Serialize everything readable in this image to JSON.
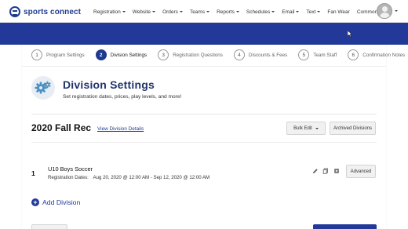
{
  "brand": {
    "name": "sports connect",
    "color": "#1f3b8f"
  },
  "nav": {
    "items": [
      {
        "label": "Registration",
        "dropdown": true
      },
      {
        "label": "Website",
        "dropdown": true
      },
      {
        "label": "Orders",
        "dropdown": true
      },
      {
        "label": "Teams",
        "dropdown": true
      },
      {
        "label": "Reports",
        "dropdown": true
      },
      {
        "label": "Schedules",
        "dropdown": true
      },
      {
        "label": "Email",
        "dropdown": true
      },
      {
        "label": "Text",
        "dropdown": true
      },
      {
        "label": "Fan Wear",
        "dropdown": false
      },
      {
        "label": "Common",
        "dropdown": true
      }
    ],
    "avatar_icon": "user-avatar-icon"
  },
  "wizard": {
    "steps": [
      {
        "number": "1",
        "label": "Program Settings",
        "active": false
      },
      {
        "number": "2",
        "label": "Division Settings",
        "active": true
      },
      {
        "number": "3",
        "label": "Registration Questions",
        "active": false
      },
      {
        "number": "4",
        "label": "Discounts & Fees",
        "active": false
      },
      {
        "number": "5",
        "label": "Team Staff",
        "active": false
      },
      {
        "number": "6",
        "label": "Confirmation Notes",
        "active": false
      }
    ]
  },
  "header": {
    "icon": "gears-icon",
    "title": "Division Settings",
    "subtitle": "Set registration dates, prices, play levels, and more!"
  },
  "season": {
    "title": "2020 Fall Rec",
    "view_link": "View Division Details",
    "bulk_edit_label": "Bulk Edit",
    "archived_label": "Archived Divisions"
  },
  "divisions": [
    {
      "index": "1",
      "name": "U10 Boys Soccer",
      "dates_label": "Registration Dates:",
      "dates_value": "Aug 20, 2020 @ 12:00 AM - Sep 12, 2020 @ 12:00 AM",
      "actions": [
        "edit-icon",
        "copy-icon",
        "delete-icon"
      ],
      "advanced_label": "Advanced"
    }
  ],
  "add_division": {
    "label": "Add Division",
    "icon": "plus-circle-icon"
  },
  "colors": {
    "accent": "#22399a",
    "title": "#22336b",
    "icon_gear": "#4a90c2"
  }
}
